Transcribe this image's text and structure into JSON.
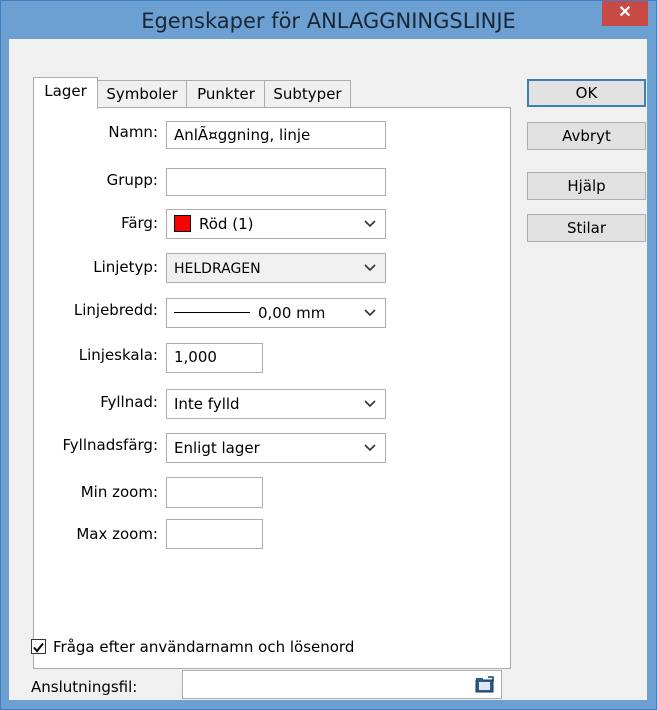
{
  "window": {
    "title": "Egenskaper för ANLAGGNINGSLINJE",
    "close_label": "✕"
  },
  "tabs": [
    {
      "label": "Lager",
      "active": true
    },
    {
      "label": "Symboler",
      "active": false
    },
    {
      "label": "Punkter",
      "active": false
    },
    {
      "label": "Subtyper",
      "active": false
    }
  ],
  "form": {
    "namn": {
      "label": "Namn:",
      "value": "AnlÃ¤ggning, linje"
    },
    "grupp": {
      "label": "Grupp:",
      "value": ""
    },
    "farg": {
      "label": "Färg:",
      "value": "Röd (1)",
      "color": "#ff0000"
    },
    "linjetyp": {
      "label": "Linjetyp:",
      "value": "HELDRAGEN"
    },
    "linjebredd": {
      "label": "Linjebredd:",
      "value": "0,00 mm"
    },
    "linjeskala": {
      "label": "Linjeskala:",
      "value": "1,000"
    },
    "fyllnad": {
      "label": "Fyllnad:",
      "value": "Inte fylld"
    },
    "fyllnadsfarg": {
      "label": "Fyllnadsfärg:",
      "value": "Enligt lager"
    },
    "min_zoom": {
      "label": "Min zoom:",
      "value": ""
    },
    "max_zoom": {
      "label": "Max zoom:",
      "value": ""
    }
  },
  "buttons": {
    "ok": "OK",
    "cancel": "Avbryt",
    "help": "Hjälp",
    "styles": "Stilar"
  },
  "footer": {
    "checkbox_label": "Fråga efter användarnamn och lösenord",
    "checkbox_checked": true,
    "connection_label": "Anslutningsfil:",
    "connection_value": ""
  },
  "icons": {
    "close": "close-icon",
    "dropdown": "chevron-down-icon",
    "browse": "folder-browse-icon",
    "check": "checkmark-icon"
  }
}
